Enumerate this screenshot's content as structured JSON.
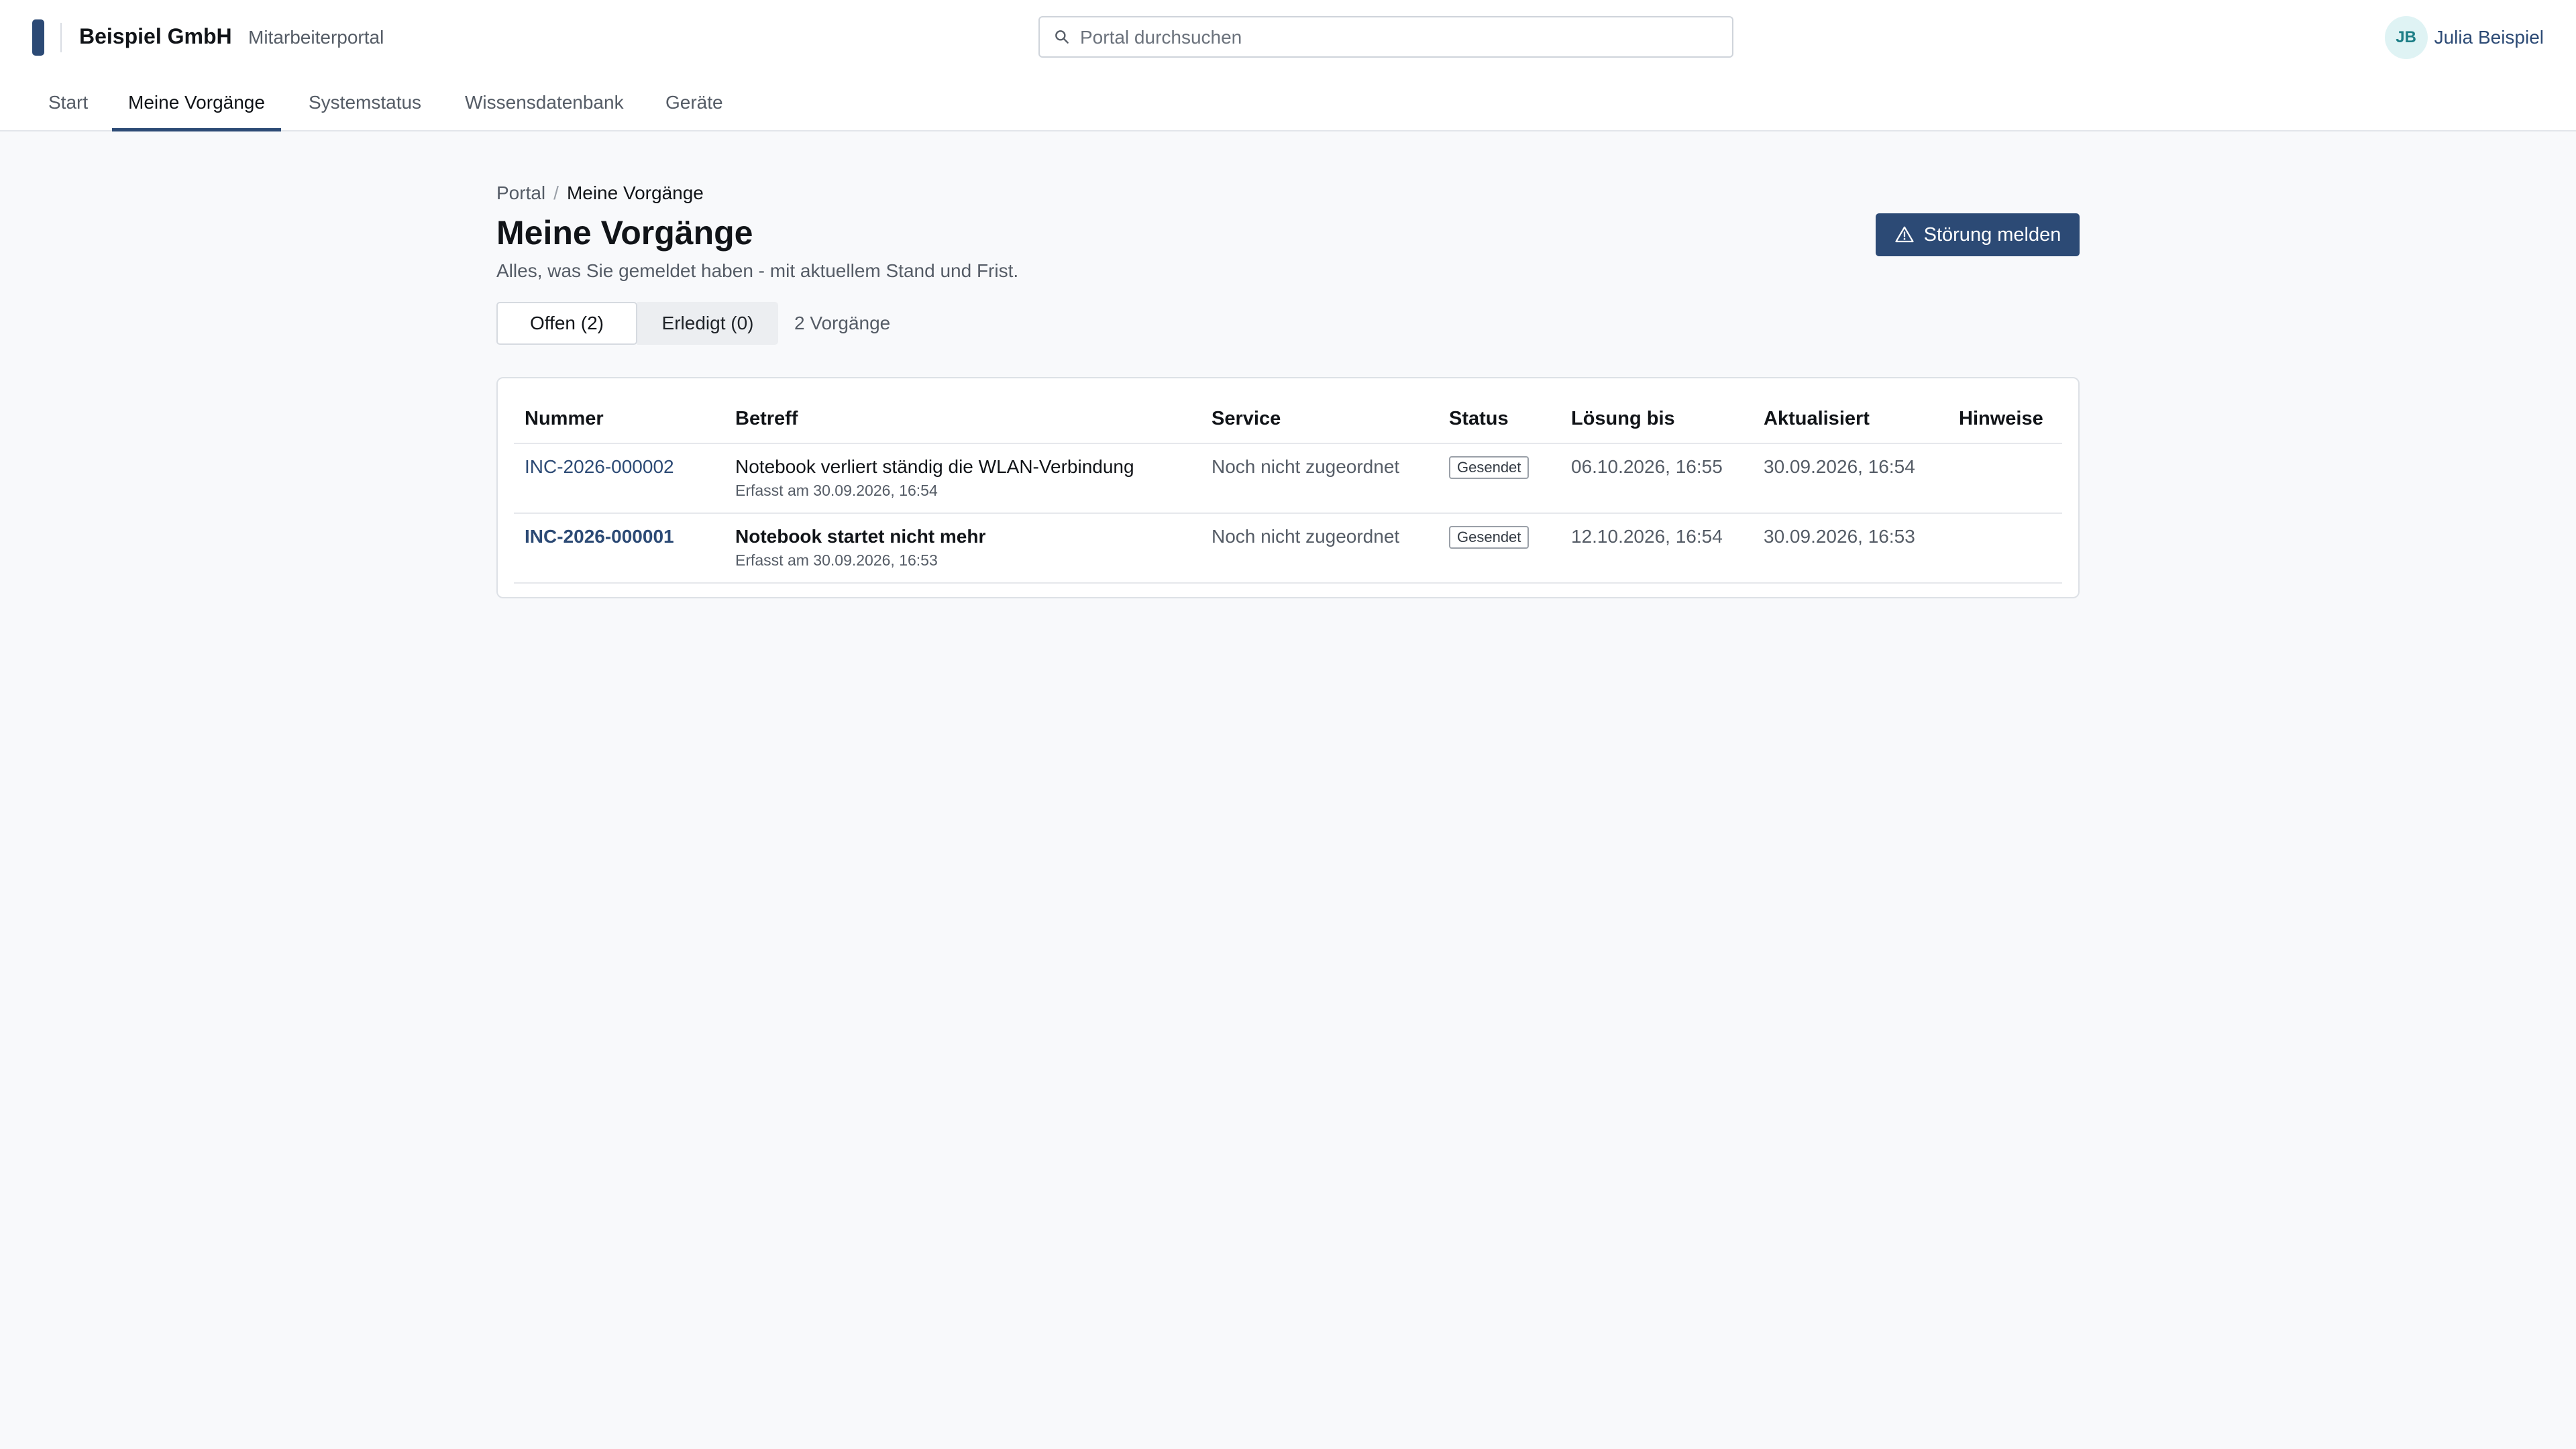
{
  "header": {
    "company": "Beispiel GmbH",
    "portal_name": "Mitarbeiterportal",
    "search_placeholder": "Portal durchsuchen",
    "user_initials": "JB",
    "user_name": "Julia Beispiel"
  },
  "nav": {
    "items": [
      {
        "label": "Start",
        "active": false
      },
      {
        "label": "Meine Vorgänge",
        "active": true
      },
      {
        "label": "Systemstatus",
        "active": false
      },
      {
        "label": "Wissensdatenbank",
        "active": false
      },
      {
        "label": "Geräte",
        "active": false
      }
    ]
  },
  "breadcrumb": {
    "root": "Portal",
    "separator": "/",
    "current": "Meine Vorgänge"
  },
  "page": {
    "title": "Meine Vorgänge",
    "subtitle": "Alles, was Sie gemeldet haben - mit aktuellem Stand und Frist.",
    "report_button": "Störung melden"
  },
  "tabs": {
    "open": "Offen (2)",
    "done": "Erledigt (0)",
    "count": "2 Vorgänge"
  },
  "table": {
    "columns": [
      "Nummer",
      "Betreff",
      "Service",
      "Status",
      "Lösung bis",
      "Aktualisiert",
      "Hinweise"
    ],
    "rows": [
      {
        "number": "INC-2026-000002",
        "subject": "Notebook verliert ständig die WLAN-Verbindung",
        "created": "Erfasst am 30.09.2026, 16:54",
        "service": "Noch nicht zugeordnet",
        "status": "Gesendet",
        "due": "06.10.2026, 16:55",
        "updated": "30.09.2026, 16:54",
        "notes": ""
      },
      {
        "number": "INC-2026-000001",
        "subject": "Notebook startet nicht mehr",
        "created": "Erfasst am 30.09.2026, 16:53",
        "service": "Noch nicht zugeordnet",
        "status": "Gesendet",
        "due": "12.10.2026, 16:54",
        "updated": "30.09.2026, 16:53",
        "notes": ""
      }
    ]
  },
  "colors": {
    "primary": "#2c4a75",
    "avatar_bg": "#dff3f4",
    "avatar_text": "#1c7e86",
    "page_bg": "#f8f9fb"
  },
  "icons": {
    "search": "search-icon",
    "report": "warning-icon"
  }
}
